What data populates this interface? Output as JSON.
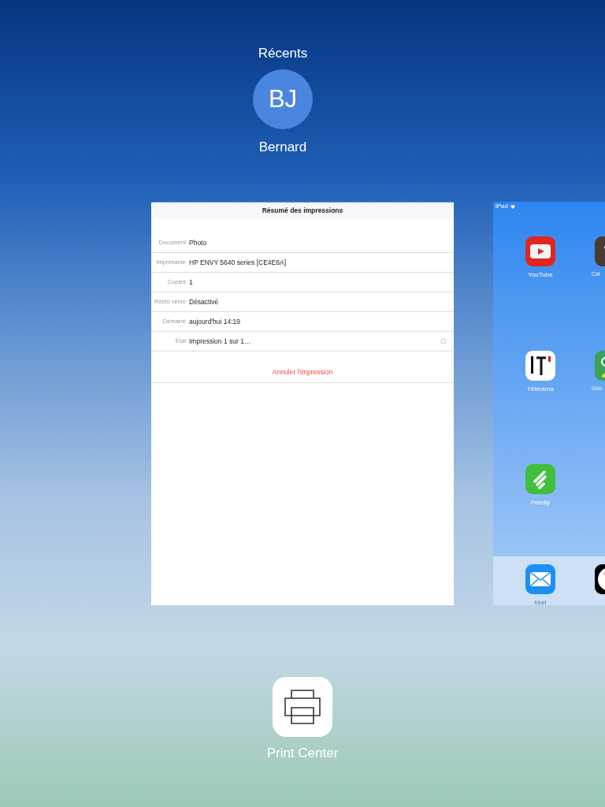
{
  "recents": {
    "title": "Récents",
    "contact": {
      "initials": "BJ",
      "name": "Bernard"
    }
  },
  "print_summary": {
    "title": "Résumé des impressions",
    "rows": [
      {
        "label": "Document",
        "value": "Photo",
        "busy": false
      },
      {
        "label": "Imprimante",
        "value": "HP ENVY 5640 series [CE4E6A]",
        "busy": false
      },
      {
        "label": "Copies",
        "value": "1",
        "busy": false
      },
      {
        "label": "Recto verso",
        "value": "Désactivé",
        "busy": false
      },
      {
        "label": "Démarré",
        "value": "aujourd'hui 14:19",
        "busy": false
      },
      {
        "label": "État",
        "value": "Impression 1 sur 1…",
        "busy": true
      }
    ],
    "cancel": "Annuler l'impression"
  },
  "home_screen": {
    "status": "iPad",
    "apps": [
      {
        "kind": "youtube",
        "label": "YouTube"
      },
      {
        "kind": "calculator",
        "label": "Cal"
      },
      {
        "kind": "telerama",
        "label": "Télérama"
      },
      {
        "kind": "maps",
        "label": "Goo"
      },
      {
        "kind": "feedly",
        "label": "Feedly"
      }
    ],
    "dock": [
      {
        "kind": "mail",
        "label": "Mail"
      },
      {
        "kind": "clock"
      }
    ]
  },
  "app": {
    "name": "Print Center"
  }
}
